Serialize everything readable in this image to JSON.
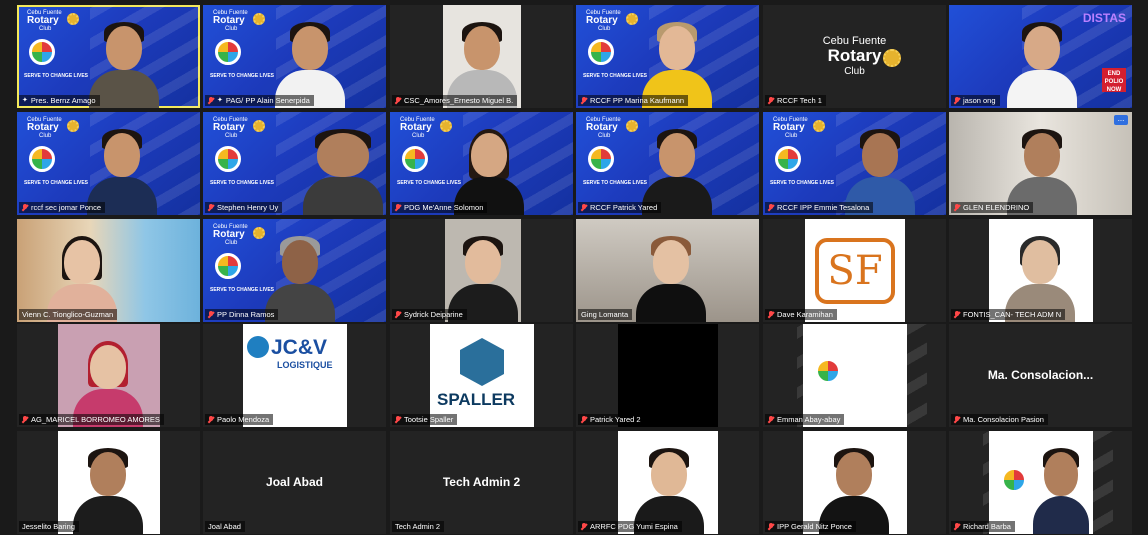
{
  "brand": {
    "line1": "Cebu Fuente",
    "line2": "Rotary",
    "line3": "Club",
    "tagline": "SERVE TO CHANGE LIVES"
  },
  "tiles": [
    {
      "name": "Pres. Bernz Amago",
      "pinned": true,
      "active": true
    },
    {
      "name": "PAG/ PP Alain Senerpida",
      "pinned": true
    },
    {
      "name": "CSC_Amores_Ernesto Miguel B."
    },
    {
      "name": "RCCF PP Marina Kaufmann"
    },
    {
      "name": "RCCF Tech 1",
      "logo": {
        "l1": "Cebu Fuente",
        "l2": "Rotary",
        "l3": "Club"
      }
    },
    {
      "name": "jason ong",
      "badge": "DISTAS",
      "badge_sub": "END POLIO NOW"
    },
    {
      "name": "rccf sec jomar Ponce"
    },
    {
      "name": "Stephen Henry Uy"
    },
    {
      "name": "PDG Me'Anne Solomon"
    },
    {
      "name": "RCCF Patrick Yared"
    },
    {
      "name": "RCCF IPP Emmie Tesalona"
    },
    {
      "name": "GLEN ELENDRINO",
      "more": "..."
    },
    {
      "name": "Vienn C. Tionglico-Guzman"
    },
    {
      "name": "PP Dinna Ramos"
    },
    {
      "name": "Sydrick Deiparine"
    },
    {
      "name": "Ging Lomanta"
    },
    {
      "name": "Dave Karamihan",
      "logo": "SF"
    },
    {
      "name": "FONTIS_CAN- TECH ADM N"
    },
    {
      "name": "AG_MARICEL BORROMEO AMORES"
    },
    {
      "name": "Paolo Mendoza",
      "logo": {
        "l1": "JC&V",
        "l2": "LOGISTIQUE"
      }
    },
    {
      "name": "Tootsie Spaller",
      "logo": "SPALLER"
    },
    {
      "name": "Patrick Yared 2"
    },
    {
      "name": "Emman Abay-abay"
    },
    {
      "name": "Ma. Consolacion Pasion",
      "big": "Ma.  Consolacion..."
    },
    {
      "name": "Jesselito Baring"
    },
    {
      "name": "Joal Abad",
      "big": "Joal Abad"
    },
    {
      "name": "Tech Admin 2",
      "big": "Tech Admin 2"
    },
    {
      "name": "ARRFC PDG Yumi Espina"
    },
    {
      "name": "IPP Gerald Nitz Ponce"
    },
    {
      "name": "Richard Barba"
    }
  ]
}
